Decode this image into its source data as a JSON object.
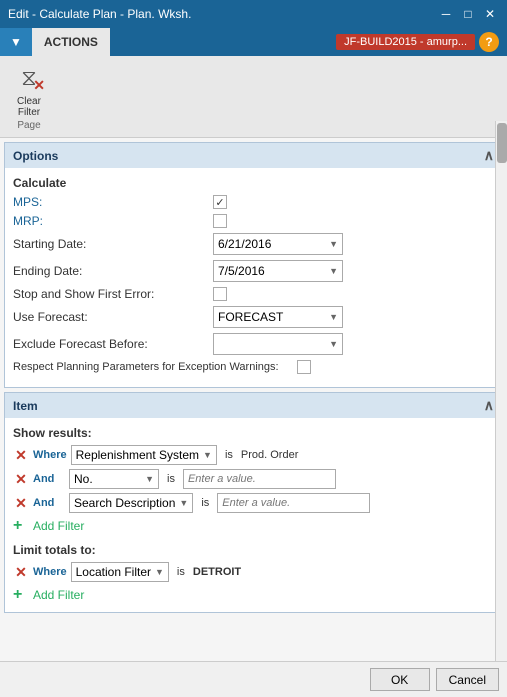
{
  "titleBar": {
    "title": "Edit - Calculate Plan - Plan. Wksh.",
    "minimize": "─",
    "maximize": "□",
    "close": "✕"
  },
  "ribbon": {
    "tabLabel": "ACTIONS",
    "dropdownLabel": "▼",
    "envBadge": "JF-BUILD2015 - amurp...",
    "helpLabel": "?",
    "clearFilter": {
      "label": "Clear\nFilter",
      "groupName": "Page"
    }
  },
  "options": {
    "sectionTitle": "Options",
    "calculate": {
      "label": "Calculate",
      "mpsLabel": "MPS:",
      "mpsChecked": true,
      "mrpLabel": "MRP:",
      "mrpChecked": false,
      "startingDateLabel": "Starting Date:",
      "startingDateValue": "6/21/2016",
      "endingDateLabel": "Ending Date:",
      "endingDateValue": "7/5/2016",
      "stopShowFirstErrorLabel": "Stop and Show First Error:",
      "stopShowFirstErrorChecked": false,
      "useForecastLabel": "Use Forecast:",
      "useForecastValue": "FORECAST",
      "excludeForecastBeforeLabel": "Exclude Forecast Before:",
      "excludeForecastBeforeValue": "",
      "respectPlanningLabel": "Respect Planning Parameters for Exception Warnings:",
      "respectPlanningChecked": false
    }
  },
  "item": {
    "sectionTitle": "Item",
    "showResults": "Show results:",
    "filters": [
      {
        "connector": "Where",
        "field": "Replenishment System",
        "operator": "is",
        "value": "Prod. Order"
      },
      {
        "connector": "And",
        "field": "No.",
        "operator": "is",
        "value": "Enter a value."
      },
      {
        "connector": "And",
        "field": "Search Description",
        "operator": "is",
        "value": "Enter a value."
      }
    ],
    "addFilter": "Add Filter",
    "limitTotals": "Limit totals to:",
    "limitFilters": [
      {
        "connector": "Where",
        "field": "Location Filter",
        "operator": "is",
        "value": "DETROIT"
      }
    ],
    "addFilter2": "Add Filter"
  },
  "footer": {
    "okLabel": "OK",
    "cancelLabel": "Cancel"
  }
}
